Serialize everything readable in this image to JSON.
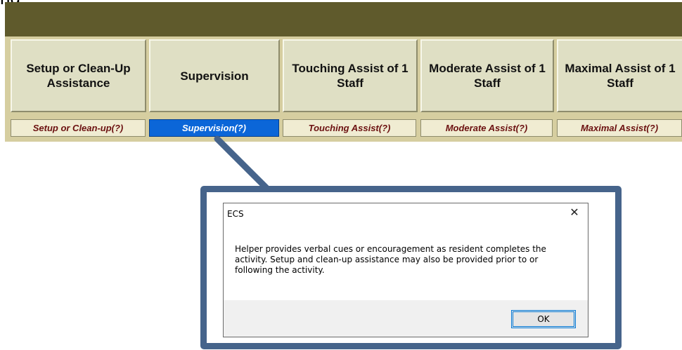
{
  "caption_fragment": "ng",
  "options": [
    {
      "label": "Setup or Clean-Up Assistance",
      "help": "Setup or Clean-up(?)"
    },
    {
      "label": "Supervision",
      "help": "Supervision(?)"
    },
    {
      "label": "Touching Assist of 1 Staff",
      "help": "Touching Assist(?)"
    },
    {
      "label": "Moderate Assist of 1 Staff",
      "help": "Moderate Assist(?)"
    },
    {
      "label": "Maximal Assist of 1 Staff",
      "help": "Maximal Assist(?)"
    }
  ],
  "dialog": {
    "title": "ECS",
    "close_glyph": "✕",
    "message": "Helper provides verbal cues or encouragement as resident completes the activity. Setup and clean-up assistance may also be provided prior to or following the activity.",
    "ok_label": "OK"
  },
  "colors": {
    "header_bar": "#5f5a2c",
    "button_face": "#dfdfc4",
    "active_help": "#0b66d8",
    "help_text": "#6b1010",
    "callout": "#46648b"
  }
}
